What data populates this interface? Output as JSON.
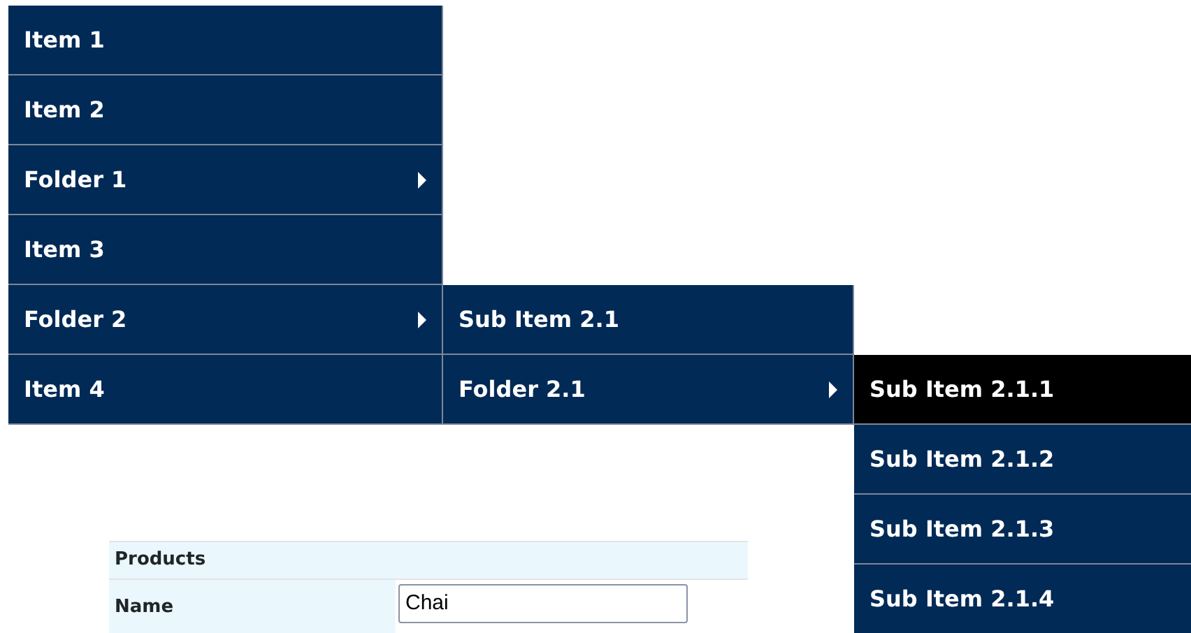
{
  "menu": [
    {
      "label": "Item 1",
      "kind": "item",
      "selected": false
    },
    {
      "label": "Item 2",
      "kind": "item",
      "selected": false
    },
    {
      "label": "Folder 1",
      "kind": "folder",
      "selected": false
    },
    {
      "label": "Item 3",
      "kind": "item",
      "selected": false
    },
    {
      "label": "Folder 2",
      "kind": "folder",
      "selected": false,
      "children": [
        {
          "label": "Sub Item 2.1",
          "kind": "item",
          "selected": false
        },
        {
          "label": "Folder 2.1",
          "kind": "folder",
          "selected": false,
          "children": [
            {
              "label": "Sub Item 2.1.1",
              "kind": "item",
              "selected": true
            },
            {
              "label": "Sub Item 2.1.2",
              "kind": "item",
              "selected": false
            },
            {
              "label": "Sub Item 2.1.3",
              "kind": "item",
              "selected": false
            },
            {
              "label": "Sub Item 2.1.4",
              "kind": "item",
              "selected": false
            }
          ]
        }
      ]
    },
    {
      "label": "Item 4",
      "kind": "item",
      "selected": false
    }
  ],
  "form": {
    "title": "Products",
    "fields": [
      {
        "label": "Name",
        "value": "Chai"
      }
    ]
  }
}
